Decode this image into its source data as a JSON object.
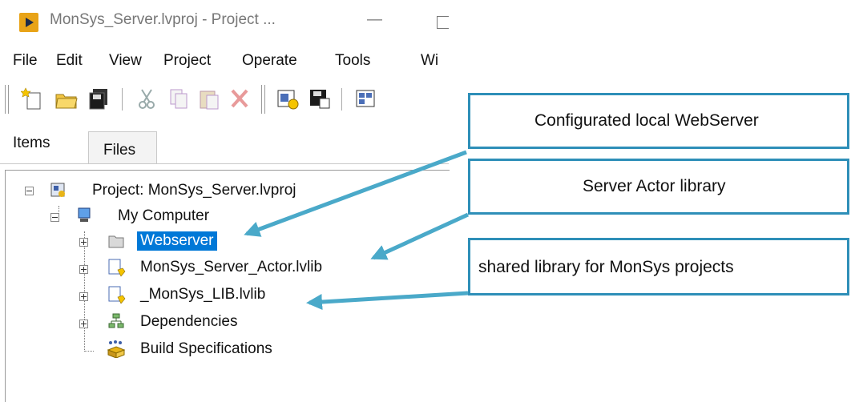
{
  "window": {
    "title": "MonSys_Server.lvproj - Project ...",
    "minimize_glyph": "—"
  },
  "menu": [
    "File",
    "Edit",
    "View",
    "Project",
    "Operate",
    "Tools",
    "Wi"
  ],
  "toolbar_icons": [
    "new-icon",
    "open-icon",
    "save-all-icon",
    "cut-icon",
    "copy-icon",
    "paste-icon",
    "delete-icon",
    "build-icon",
    "save-icon",
    "view-icon"
  ],
  "tabs": {
    "items": "Items",
    "files": "Files"
  },
  "tree": {
    "project": "Project: MonSys_Server.lvproj",
    "my_computer": "My Computer",
    "webserver": "Webserver",
    "server_actor": "MonSys_Server_Actor.lvlib",
    "monsys_lib": "_MonSys_LIB.lvlib",
    "dependencies": "Dependencies",
    "build_specs": "Build Specifications"
  },
  "callouts": {
    "webserver": "Configurated local WebServer",
    "actor": "Server Actor library",
    "shared": "shared library for MonSys projects"
  },
  "colors": {
    "selection": "#0078d7",
    "callout_border": "#2e8fb8",
    "arrow": "#4aa9c9"
  }
}
